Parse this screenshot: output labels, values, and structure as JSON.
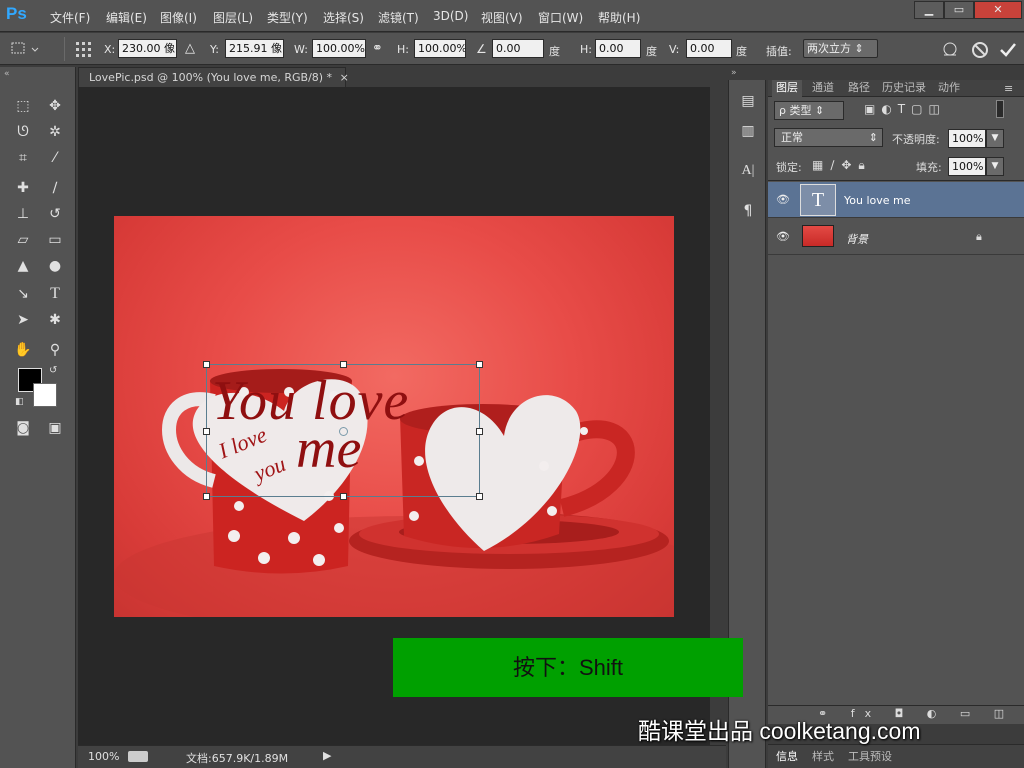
{
  "app": {
    "logo": "Ps"
  },
  "menu": [
    "文件(F)",
    "编辑(E)",
    "图像(I)",
    "图层(L)",
    "类型(Y)",
    "选择(S)",
    "滤镜(T)",
    "3D(D)",
    "视图(V)",
    "窗口(W)",
    "帮助(H)"
  ],
  "window_buttons": {
    "min": "▁",
    "max": "▭",
    "close": "✕"
  },
  "options": {
    "x_label": "X:",
    "x_value": "230.00 像",
    "y_label": "Y:",
    "y_value": "215.91 像",
    "w_label": "W:",
    "w_value": "100.00%",
    "h_label": "H:",
    "h_value": "100.00%",
    "angle_value": "0.00",
    "angle_unit": "度",
    "hskew_label": "H:",
    "hskew_value": "0.00",
    "hskew_unit": "度",
    "vskew_label": "V:",
    "vskew_value": "0.00",
    "vskew_unit": "度",
    "interp_label": "插值:",
    "interp_value": "两次立方"
  },
  "document": {
    "tab_title": "LovePic.psd @ 100% (You love me, RGB/8) *",
    "tab_close": "×",
    "zoom": "100%",
    "doc_info": "文档:657.9K/1.89M"
  },
  "canvas_text": {
    "line1": "You love",
    "line2": "me",
    "cup_text1": "I love",
    "cup_text2": "you"
  },
  "layers_panel": {
    "tabs": [
      "图层",
      "通道",
      "路径",
      "历史记录",
      "动作"
    ],
    "filter_kind": "ρ 类型",
    "blend_mode": "正常",
    "opacity_label": "不透明度:",
    "opacity_value": "100%",
    "lock_label": "锁定:",
    "fill_label": "填充:",
    "fill_value": "100%",
    "layers": [
      {
        "name": "You love me",
        "type": "text",
        "selected": true
      },
      {
        "name": "背景",
        "type": "image",
        "locked": true
      }
    ],
    "bottom_tabs": [
      "信息",
      "样式",
      "工具预设"
    ]
  },
  "overlay": {
    "key_hint": "按下：Shift",
    "watermark": "酷课堂出品 coolketang.com"
  },
  "colors": {
    "accent": "#31a8ff",
    "selected_layer": "#5b7394",
    "key_hint_bg": "#00a000"
  }
}
